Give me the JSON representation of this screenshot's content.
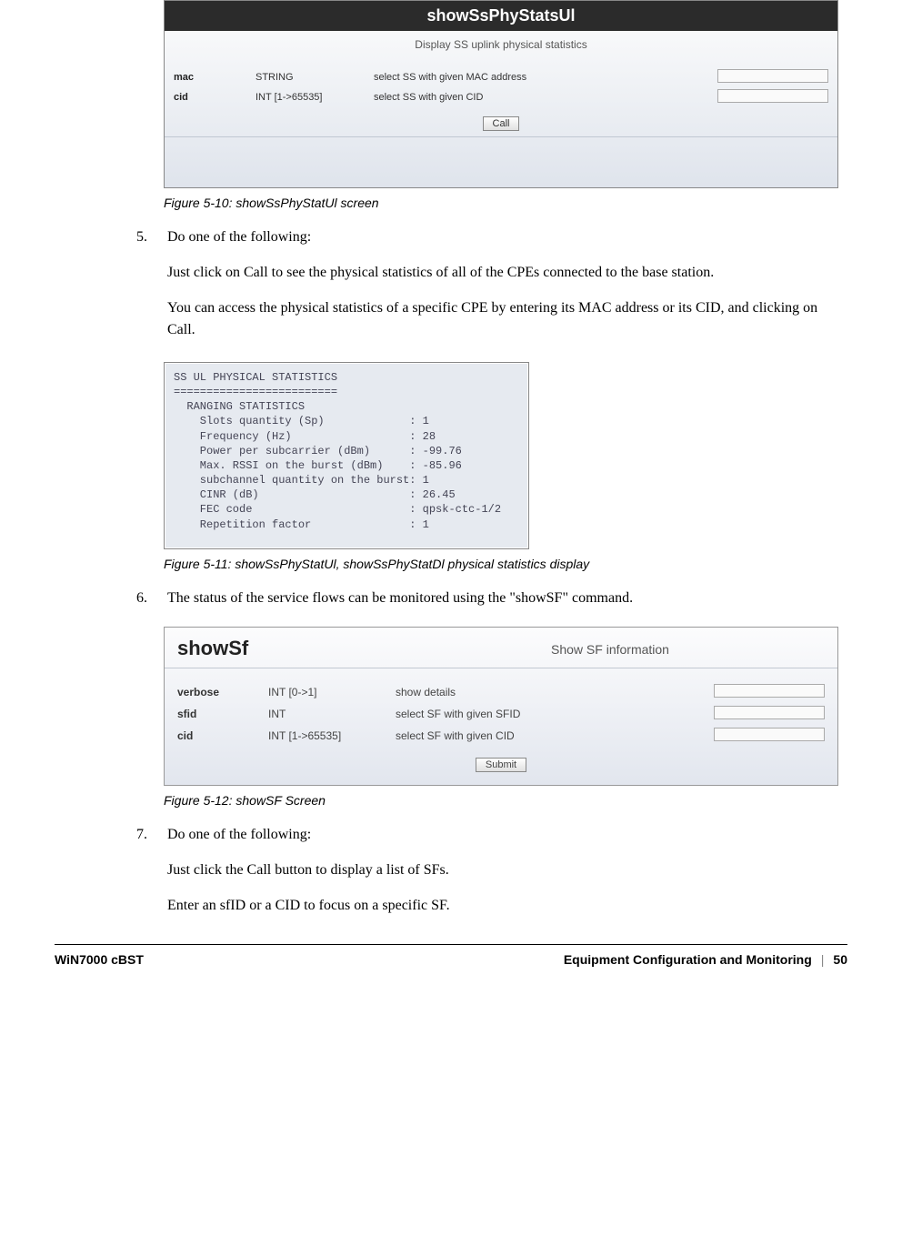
{
  "panel1": {
    "title": "showSsPhyStatsUl",
    "subtitle": "Display SS uplink physical statistics",
    "rows": [
      {
        "name": "mac",
        "type": "STRING",
        "desc": "select SS with given MAC address"
      },
      {
        "name": "cid",
        "type": "INT [1->65535]",
        "desc": "select SS with given CID"
      }
    ],
    "button": "Call"
  },
  "caption1_a": "Figure 5-10: showSsPhyStatUl ",
  "caption1_b": "screen",
  "item5_num": "5.",
  "item5_txt": "Do one of the following:",
  "para5a": "Just click on Call to see the physical statistics of all of the CPEs connected to the base station.",
  "para5b": "You can access the physical statistics of a specific CPE by entering its MAC address or its CID, and clicking on Call.",
  "stats": {
    "title": "SS UL PHYSICAL STATISTICS",
    "sep": "=========================",
    "heading": "  RANGING STATISTICS",
    "lines": [
      "    Slots quantity (Sp)             : 1",
      "    Frequency (Hz)                  : 28",
      "    Power per subcarrier (dBm)      : -99.76",
      "    Max. RSSI on the burst (dBm)    : -85.96",
      "    subchannel quantity on the burst: 1",
      "    CINR (dB)                       : 26.45",
      "    FEC code                        : qpsk-ctc-1/2",
      "    Repetition factor               : 1"
    ]
  },
  "caption2": "Figure 5-11: showSsPhyStatUl, showSsPhyStatDl physical statistics display",
  "item6_num": "6.",
  "item6_txt": "The status of the service flows can be monitored using the \"showSF\" command.",
  "panel3": {
    "title": "showSf",
    "desc": "Show SF information",
    "rows": [
      {
        "name": "verbose",
        "type": "INT [0->1]",
        "desc": "show details"
      },
      {
        "name": "sfid",
        "type": "INT",
        "desc": "select SF with given SFID"
      },
      {
        "name": "cid",
        "type": "INT [1->65535]",
        "desc": "select SF with given CID"
      }
    ],
    "button": "Submit"
  },
  "caption3": "Figure 5-12: showSF Screen",
  "item7_num": "7.",
  "item7_txt": "Do one of the following:",
  "para7a": "Just click the Call button to display a list of SFs.",
  "para7b": "Enter an sfID or a CID to focus on a specific SF.",
  "footer": {
    "left": "WiN7000 cBST",
    "center": "Equipment Configuration and Monitoring",
    "sep": "|",
    "page": "50"
  }
}
